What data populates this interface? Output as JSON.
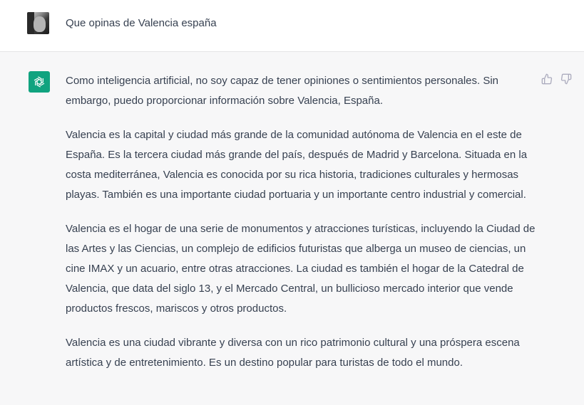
{
  "user": {
    "avatar_icon": "user-photo-avatar",
    "message": "Que opinas de Valencia españa"
  },
  "assistant": {
    "avatar_icon": "openai-logo-icon",
    "brand_color": "#10a37f",
    "paragraphs": [
      "Como inteligencia artificial, no soy capaz de tener opiniones o sentimientos personales. Sin embargo, puedo proporcionar información sobre Valencia, España.",
      "Valencia es la capital y ciudad más grande de la comunidad autónoma de Valencia en el este de España. Es la tercera ciudad más grande del país, después de Madrid y Barcelona. Situada en la costa mediterránea, Valencia es conocida por su rica historia, tradiciones culturales y hermosas playas. También es una importante ciudad portuaria y un importante centro industrial y comercial.",
      "Valencia es el hogar de una serie de monumentos y atracciones turísticas, incluyendo la Ciudad de las Artes y las Ciencias, un complejo de edificios futuristas que alberga un museo de ciencias, un cine IMAX y un acuario, entre otras atracciones. La ciudad es también el hogar de la Catedral de Valencia, que data del siglo 13, y el Mercado Central, un bullicioso mercado interior que vende productos frescos, mariscos y otros productos.",
      "Valencia es una ciudad vibrante y diversa con un rico patrimonio cultural y una próspera escena artística y de entretenimiento. Es un destino popular para turistas de todo el mundo."
    ],
    "feedback_icons": [
      "thumbs-up-icon",
      "thumbs-down-icon"
    ]
  }
}
